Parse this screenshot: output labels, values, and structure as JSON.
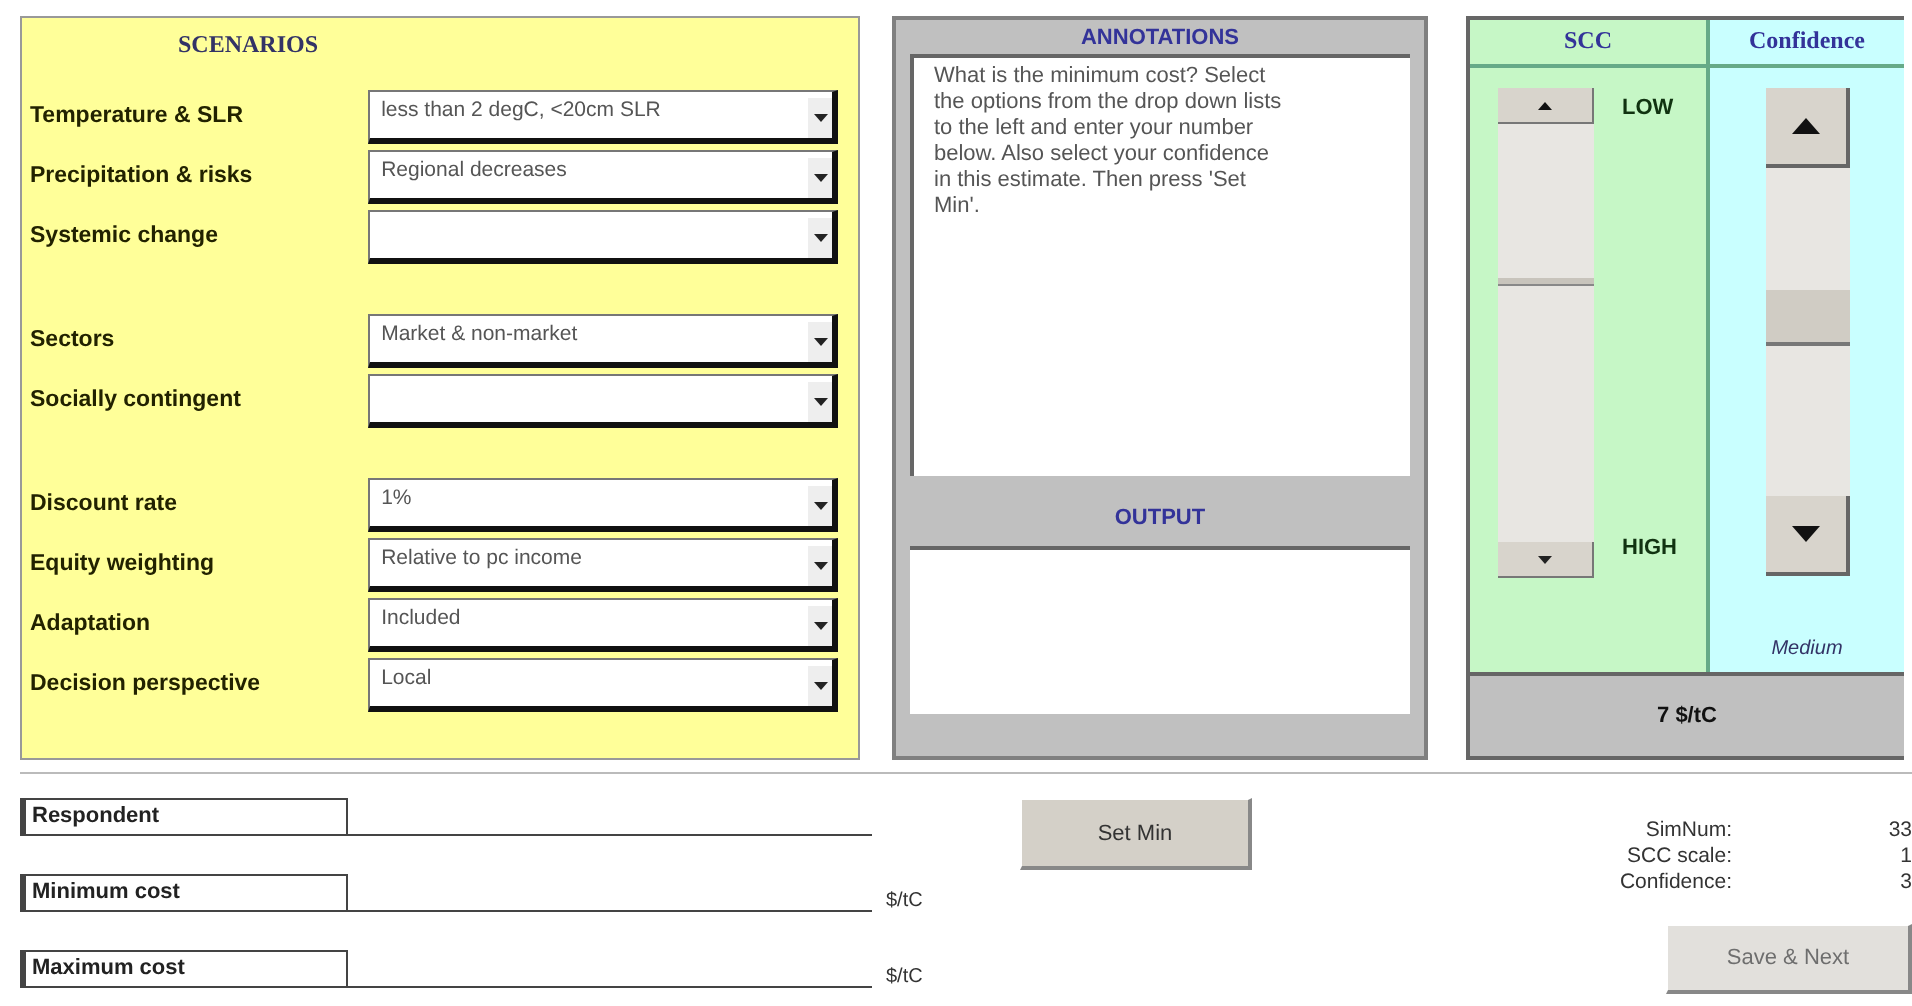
{
  "scenarios": {
    "title": "SCENARIOS",
    "groups": [
      [
        {
          "label": "Temperature & SLR",
          "value": "less than 2 degC, <20cm SLR"
        },
        {
          "label": "Precipitation & risks",
          "value": "Regional decreases"
        },
        {
          "label": "Systemic change"
        }
      ],
      [
        {
          "label": "Sectors",
          "value": "Market & non-market"
        },
        {
          "label": "Socially contingent"
        }
      ],
      [
        {
          "label": "Discount rate",
          "value": "1%"
        },
        {
          "label": "Equity weighting",
          "value": "Relative to pc income"
        },
        {
          "label": "Adaptation",
          "value": "Included"
        },
        {
          "label": "Decision perspective",
          "value": "Local"
        }
      ]
    ]
  },
  "annotations": {
    "title": "ANNOTATIONS",
    "text": "What is the minimum cost? Select the options from the drop down lists to the left and enter your number below. Also select your confidence in this estimate. Then press 'Set Min'.",
    "output_title": "OUTPUT"
  },
  "scc": {
    "title": "SCC",
    "low_label": "LOW",
    "high_label": "HIGH"
  },
  "confidence": {
    "title": "Confidence",
    "reading": "Medium"
  },
  "result": "7  $/tC",
  "inputs": [
    {
      "label": "Respondent"
    },
    {
      "label": "Minimum cost",
      "unit": "$/tC"
    },
    {
      "label": "Maximum cost",
      "unit": "$/tC"
    }
  ],
  "set_min_button": {
    "label": "Set Min"
  },
  "stats": [
    {
      "label": "SimNum:",
      "value": "33"
    },
    {
      "label": "SCC scale:",
      "value": "1"
    },
    {
      "label": "Confidence:",
      "value": "3"
    }
  ],
  "save_button": {
    "label": "Save & Next",
    "disabled": true
  }
}
